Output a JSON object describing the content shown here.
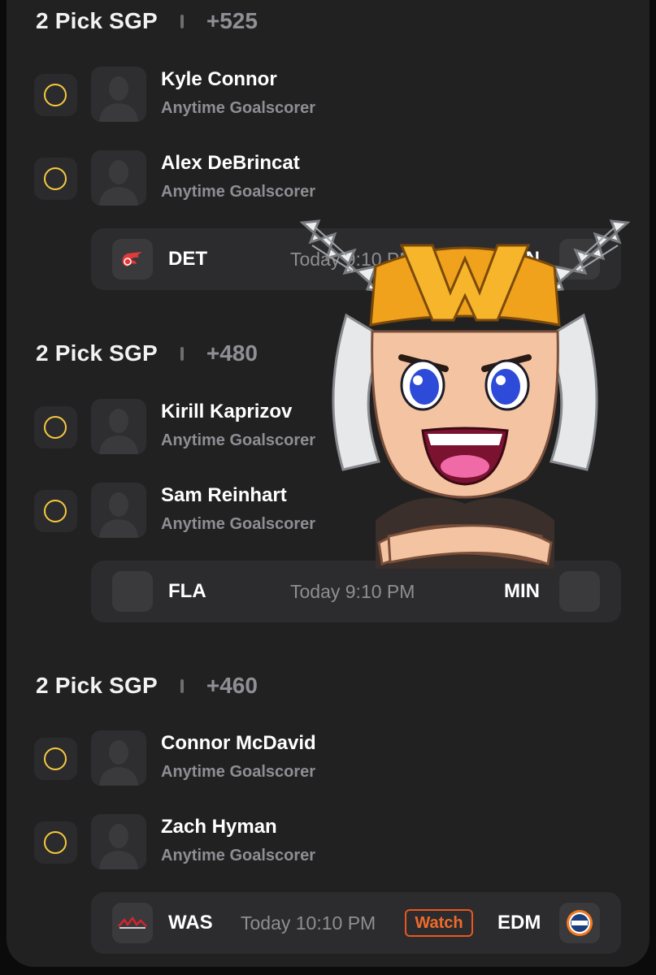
{
  "sections": [
    {
      "title": "2 Pick SGP",
      "odds": "+525",
      "picks": [
        {
          "player": "Kyle Connor",
          "market": "Anytime Goalscorer"
        },
        {
          "player": "Alex DeBrincat",
          "market": "Anytime Goalscorer"
        }
      ],
      "game": {
        "home": "DET",
        "time": "Today 9:10 PM",
        "away": "MIN",
        "home_logo": "red-wings-logo",
        "away_logo": "wild-logo"
      }
    },
    {
      "title": "2 Pick SGP",
      "odds": "+480",
      "picks": [
        {
          "player": "Kirill Kaprizov",
          "market": "Anytime Goalscorer"
        },
        {
          "player": "Sam Reinhart",
          "market": "Anytime Goalscorer"
        }
      ],
      "game": {
        "home": "FLA",
        "time": "Today 9:10 PM",
        "away": "MIN",
        "home_logo": "panthers-logo",
        "away_logo": "wild-logo"
      }
    },
    {
      "title": "2 Pick SGP",
      "odds": "+460",
      "picks": [
        {
          "player": "Connor McDavid",
          "market": "Anytime Goalscorer"
        },
        {
          "player": "Zach Hyman",
          "market": "Anytime Goalscorer"
        }
      ],
      "game": {
        "home": "WAS",
        "time": "Today 10:10 PM",
        "watch_label": "Watch",
        "away": "EDM",
        "home_logo": "capitals-logo",
        "away_logo": "oilers-logo"
      }
    }
  ],
  "colors": {
    "panel": "#212122",
    "check_ring": "#f6c93e",
    "watch_accent": "#e8571f",
    "muted_text": "#8e8e93"
  },
  "icons": {
    "pick_toggle": "empty-circle-icon",
    "player_avatar": "person-silhouette-icon",
    "overlay": "winged-helmet-mascot-sticker"
  }
}
